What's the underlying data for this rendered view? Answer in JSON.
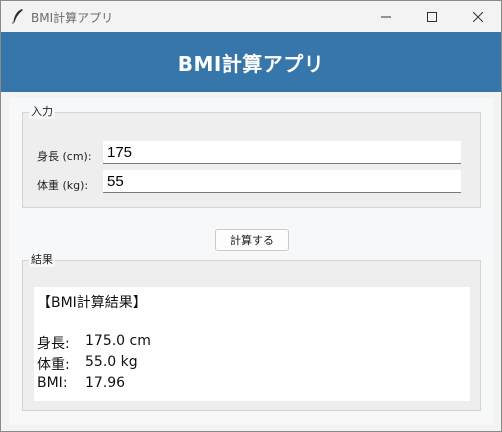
{
  "window": {
    "title": "BMI計算アプリ",
    "icon": "feather-icon"
  },
  "header": {
    "title": "BMI計算アプリ",
    "background": "#3776ab"
  },
  "input_section": {
    "legend": "入力",
    "height_label": "身長 (cm):",
    "height_value": "175",
    "weight_label": "体重 (kg):",
    "weight_value": "55"
  },
  "calc_button": {
    "label": "計算する"
  },
  "result_section": {
    "legend": "結果",
    "heading": "【BMI計算結果】",
    "rows": [
      {
        "key": "身長:",
        "value": "175.0 cm"
      },
      {
        "key": "体重:",
        "value": "55.0 kg"
      },
      {
        "key": "BMI:",
        "value": "17.96"
      }
    ]
  }
}
